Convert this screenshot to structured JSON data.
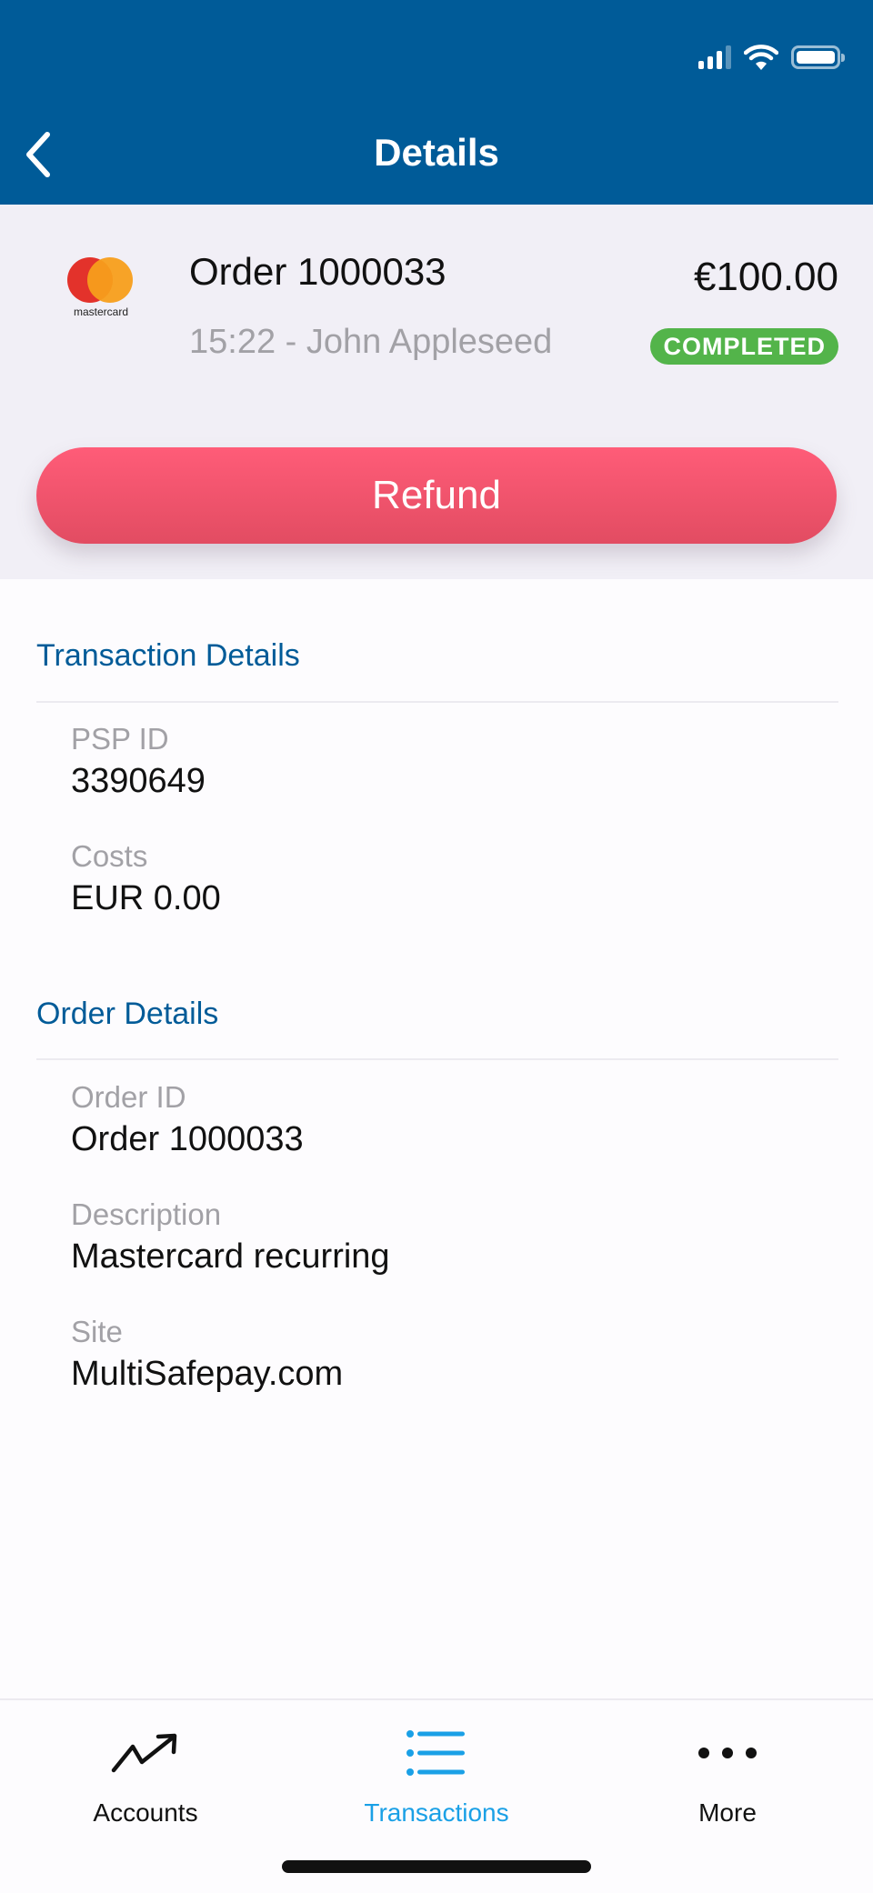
{
  "nav": {
    "title": "Details",
    "back_icon": "chevron-left-icon"
  },
  "status_bar": {
    "signal_bars": 3,
    "signal_total": 4,
    "wifi": true,
    "battery_percent": 100
  },
  "transaction": {
    "payment_method": "mastercard",
    "title": "Order 1000033",
    "subtitle": "15:22 - John Appleseed",
    "amount": "€100.00",
    "status": "COMPLETED",
    "status_color": "#53b44a"
  },
  "refund_button": {
    "label": "Refund",
    "color": "#f05570"
  },
  "sections": [
    {
      "title": "Transaction Details",
      "fields": [
        {
          "label": "PSP ID",
          "value": "3390649"
        },
        {
          "label": "Costs",
          "value": "EUR 0.00"
        }
      ]
    },
    {
      "title": "Order Details",
      "fields": [
        {
          "label": "Order ID",
          "value": "Order 1000033"
        },
        {
          "label": "Description",
          "value": "Mastercard recurring"
        },
        {
          "label": "Site",
          "value": "MultiSafepay.com"
        }
      ]
    }
  ],
  "tabs": [
    {
      "label": "Accounts",
      "icon": "trending-up-icon",
      "active": false
    },
    {
      "label": "Transactions",
      "icon": "list-icon",
      "active": true
    },
    {
      "label": "More",
      "icon": "more-icon",
      "active": false
    }
  ],
  "colors": {
    "brand": "#005b98",
    "accent": "#1aa0e6"
  }
}
